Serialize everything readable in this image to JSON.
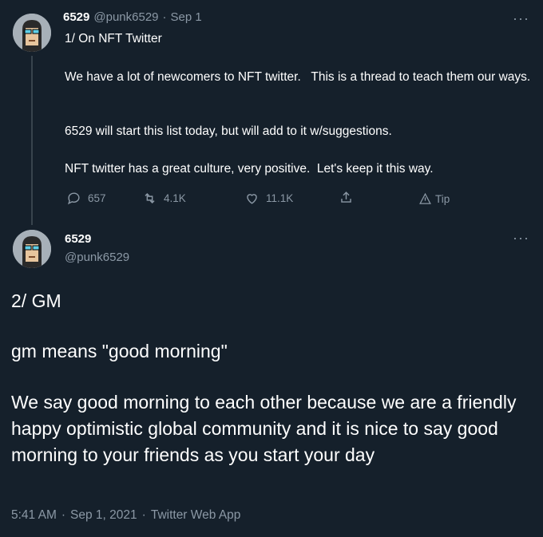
{
  "tweet1": {
    "display_name": "6529",
    "handle": "@punk6529",
    "separator": "·",
    "date": "Sep 1",
    "paragraphs": [
      "1/ On NFT Twitter",
      "We have a lot of newcomers to NFT twitter.   This is a thread to teach them our ways.",
      "6529 will start this list today, but will add to it w/suggestions.",
      "NFT twitter has a great culture, very positive.  Let's keep it this way."
    ],
    "actions": {
      "reply_count": "657",
      "retweet_count": "4.1K",
      "like_count": "11.1K",
      "tip_label": "Tip"
    },
    "more_label": "···"
  },
  "tweet2": {
    "display_name": "6529",
    "handle": "@punk6529",
    "more_label": "···",
    "paragraphs": [
      "2/ GM",
      "gm means \"good morning\"",
      "We say good morning to each other because we are a friendly happy optimistic global community and it is nice to say good morning to your friends as you start your day"
    ],
    "time": "5:41 AM",
    "date": "Sep 1, 2021",
    "source": "Twitter Web App",
    "separator": "·"
  },
  "colors": {
    "background": "#15202b",
    "text": "#ffffff",
    "muted": "#8b98a5",
    "thread_line": "#38444d"
  },
  "icons": [
    "reply-icon",
    "retweet-icon",
    "like-icon",
    "share-icon",
    "tip-icon",
    "more-icon",
    "avatar"
  ]
}
